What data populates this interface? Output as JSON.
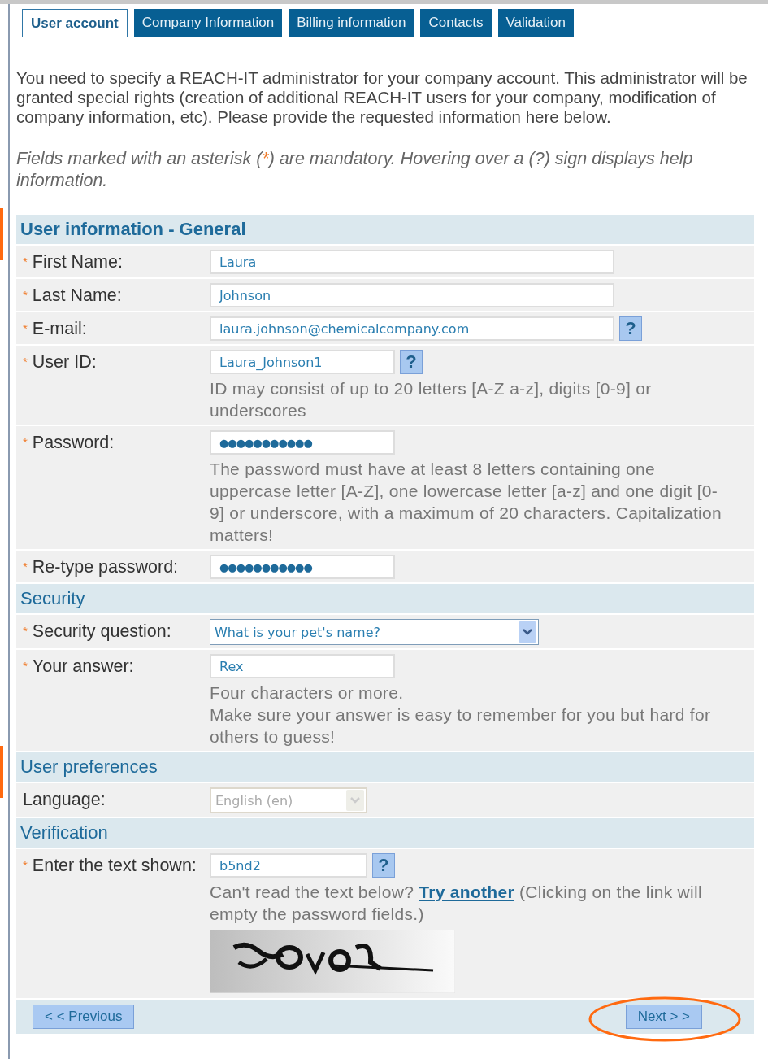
{
  "tabs": [
    {
      "label": "User account",
      "selected": true
    },
    {
      "label": "Company Information",
      "selected": false
    },
    {
      "label": "Billing information",
      "selected": false
    },
    {
      "label": "Contacts",
      "selected": false
    },
    {
      "label": "Validation",
      "selected": false
    }
  ],
  "intro": "You need to specify a REACH-IT administrator for your company account. This administrator will be granted special rights (creation of additional REACH-IT users for your company, modification of company information, etc). Please provide the requested information here below.",
  "note": {
    "before": "Fields marked with an asterisk (",
    "mark": "*",
    "after": ") are mandatory. Hovering over a (?) sign displays help information."
  },
  "sections": [
    {
      "title": "User information - General",
      "kind": "main",
      "marked": true,
      "rows": [
        {
          "label": "First Name:",
          "required": true,
          "field": {
            "kind": "text",
            "value": "Laura"
          }
        },
        {
          "label": "Last Name:",
          "required": true,
          "field": {
            "kind": "text",
            "value": "Johnson"
          }
        },
        {
          "label": "E-mail:",
          "required": true,
          "field": {
            "kind": "text",
            "value": "laura.johnson@chemicalcompany.com"
          },
          "help": "?"
        },
        {
          "label": "User ID:",
          "required": true,
          "field": {
            "kind": "text",
            "value": "Laura_Johnson1"
          },
          "help": "?",
          "hint": "ID may consist of up to 20 letters [A-Z a-z], digits [0-9] or underscores"
        },
        {
          "label": "Password:",
          "required": true,
          "field": {
            "kind": "password",
            "value": "●●●●●●●●●●●"
          },
          "hint": "The password must have at least 8 letters containing one uppercase letter [A-Z], one lowercase letter [a-z] and one digit [0-9] or underscore, with a maximum of 20 characters. Capitalization matters!"
        },
        {
          "label": "Re-type password:",
          "required": true,
          "field": {
            "kind": "password",
            "value": "●●●●●●●●●●●"
          }
        }
      ]
    },
    {
      "title": "Security",
      "kind": "sub",
      "marked": false,
      "rows": [
        {
          "label": "Security question:",
          "required": true,
          "field": {
            "kind": "select",
            "value": "What is your pet's name?",
            "disabled": false
          }
        },
        {
          "label": "Your answer:",
          "required": true,
          "field": {
            "kind": "text",
            "value": "Rex"
          },
          "hint": "Four characters or more.\nMake sure your answer is easy to remember for you but hard for others to guess!"
        }
      ]
    },
    {
      "title": "User preferences",
      "kind": "sub",
      "marked": true,
      "rows": [
        {
          "label": "Language:",
          "required": false,
          "field": {
            "kind": "select",
            "value": "English (en)",
            "disabled": true
          }
        }
      ]
    },
    {
      "title": "Verification",
      "kind": "sub",
      "marked": false,
      "rows": [
        {
          "label": "Enter the text shown:",
          "required": true,
          "field": {
            "kind": "text",
            "value": "b5nd2"
          },
          "help": "?",
          "captcha": {
            "before": "Can't read the text below?",
            "link": "Try another",
            "after": "(Clicking on the link will empty the password fields.)"
          }
        }
      ]
    }
  ],
  "footer": {
    "previous": {
      "label": "< < Previous"
    },
    "next": {
      "label": "Next > >",
      "highlighted": true
    }
  }
}
